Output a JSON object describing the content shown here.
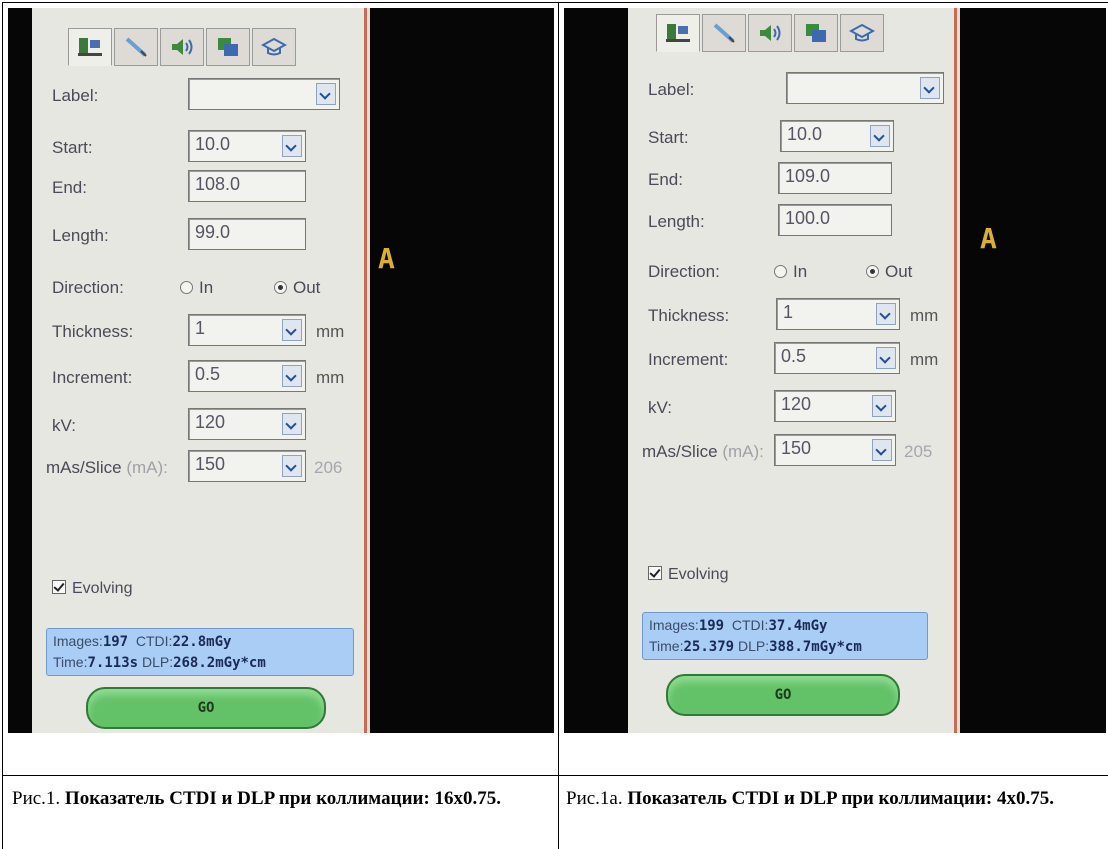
{
  "figures": [
    {
      "labels": {
        "label": "Label:",
        "start": "Start:",
        "end": "End:",
        "length": "Length:",
        "direction": "Direction:",
        "thickness": "Thickness:",
        "increment": "Increment:",
        "kv": "kV:",
        "mas": "mAs/Slice",
        "mas_unit": "(mA):"
      },
      "values": {
        "start": "10.0",
        "end": "108.0",
        "length": "99.0",
        "thickness": "1",
        "increment": "0.5",
        "kv": "120",
        "mas": "150",
        "mas_extra": "206"
      },
      "direction_in": "In",
      "direction_out": "Out",
      "unit_mm": "mm",
      "evolving": "Evolving",
      "stats": {
        "images_label": "Images:",
        "images": "197",
        "ctdi_label": "CTDI:",
        "ctdi": "22.8mGy",
        "time_label": "Time:",
        "time": "7.113s",
        "dlp_label": "DLP:",
        "dlp": "268.2mGy*cm"
      },
      "go": "GO",
      "marker": "A",
      "caption": {
        "prefix": "Рис.1.",
        "text": "Показатель CTDI и DLP при коллимации: 16x0.75."
      }
    },
    {
      "labels": {
        "label": "Label:",
        "start": "Start:",
        "end": "End:",
        "length": "Length:",
        "direction": "Direction:",
        "thickness": "Thickness:",
        "increment": "Increment:",
        "kv": "kV:",
        "mas": "mAs/Slice",
        "mas_unit": "(mA):"
      },
      "values": {
        "start": "10.0",
        "end": "109.0",
        "length": "100.0",
        "thickness": "1",
        "increment": "0.5",
        "kv": "120",
        "mas": "150",
        "mas_extra": "205"
      },
      "direction_in": "In",
      "direction_out": "Out",
      "unit_mm": "mm",
      "evolving": "Evolving",
      "stats": {
        "images_label": "Images:",
        "images": "199",
        "ctdi_label": "CTDI:",
        "ctdi": "37.4mGy",
        "time_label": "Time:",
        "time": "25.379",
        "dlp_label": "DLP:",
        "dlp": "388.7mGy*cm"
      },
      "go": "GO",
      "marker": "A",
      "caption": {
        "prefix": "Рис.1а.",
        "text": "Показатель CTDI и DLP при коллимации: 4x0.75."
      }
    }
  ],
  "colors": {
    "panel": "#e7e7e1",
    "stats_bg": "#a9cdf4",
    "go_button": "#63c167",
    "marker": "#d9b030"
  },
  "tab_icons": [
    "scan-settings-icon",
    "injector-icon",
    "audio-icon",
    "recon-icon",
    "training-icon"
  ]
}
